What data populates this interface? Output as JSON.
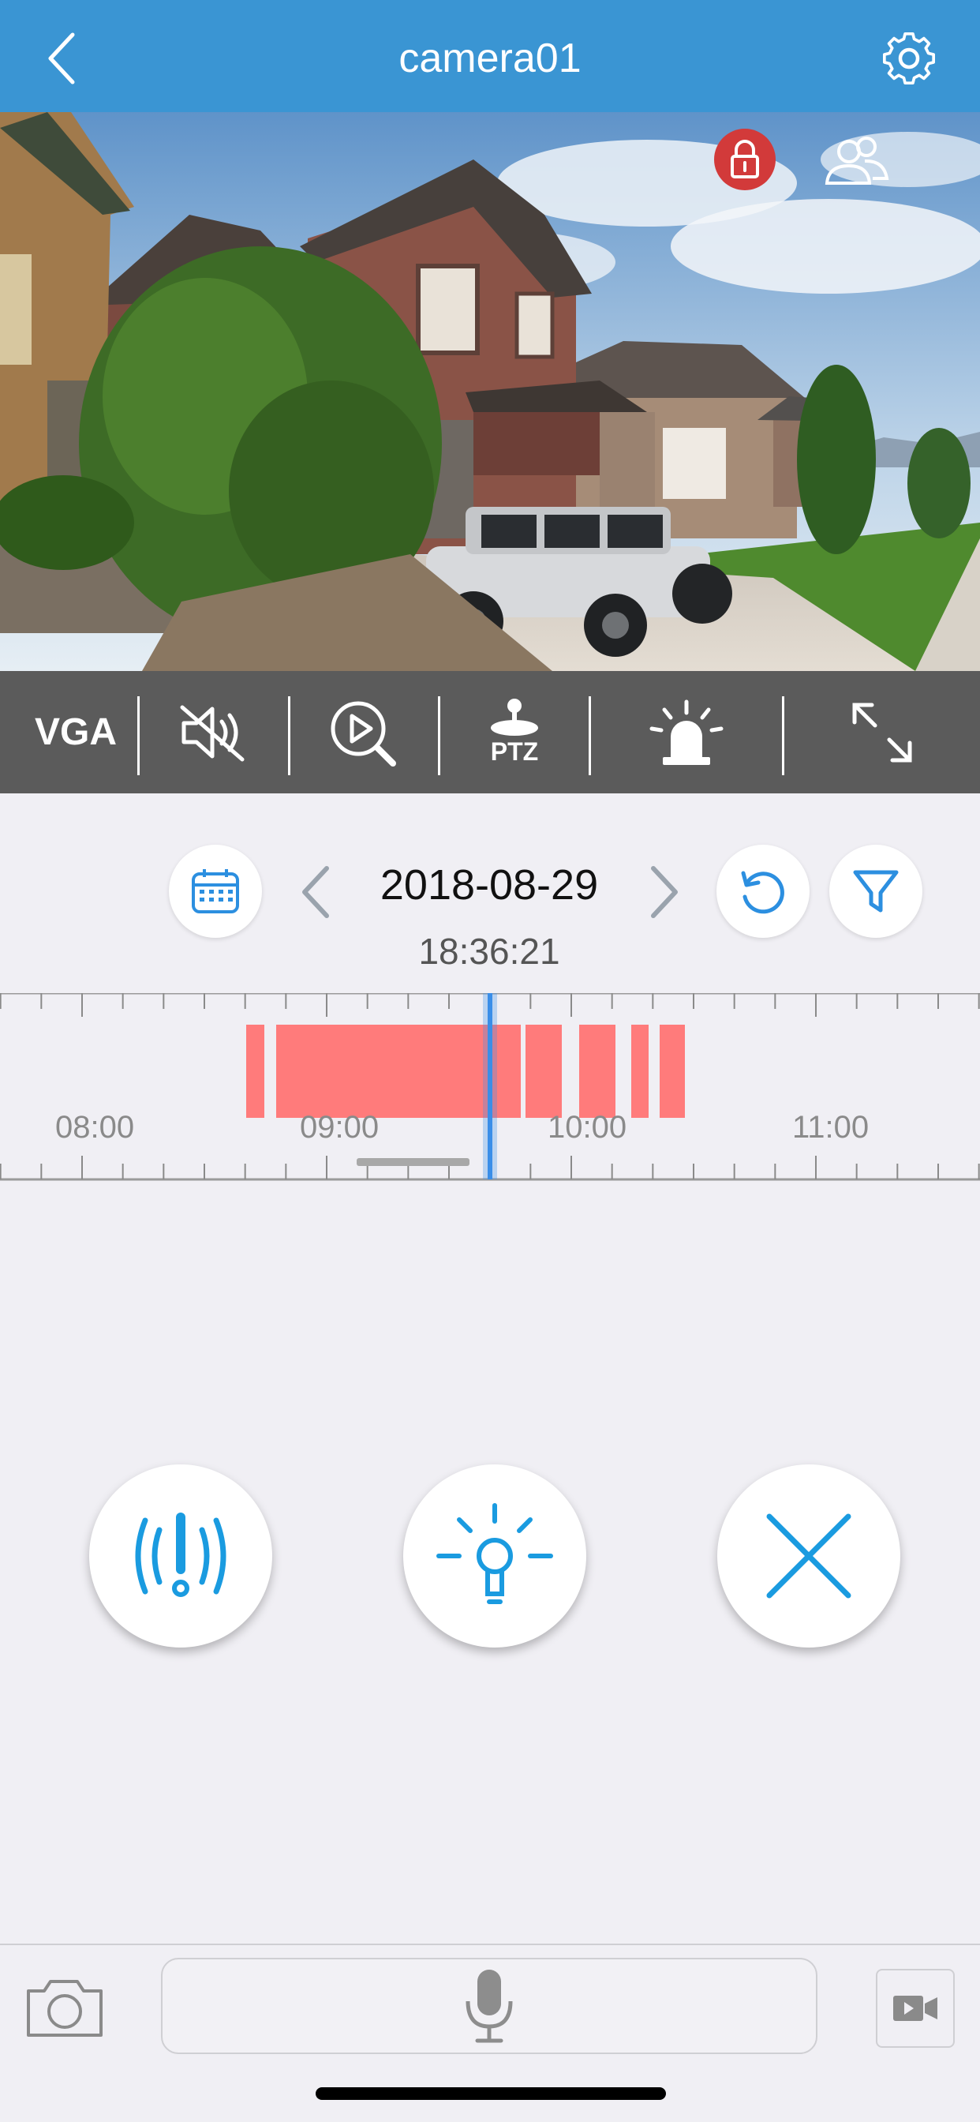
{
  "header": {
    "title": "camera01",
    "back_icon": "chevron-left-icon",
    "settings_icon": "gear-icon"
  },
  "video": {
    "lock_icon": "lock-icon",
    "users_icon": "users-icon",
    "lock_color": "#d23a3a"
  },
  "toolbar": {
    "resolution_label": "VGA",
    "mute_icon": "speaker-muted-icon",
    "playback_icon": "playback-search-icon",
    "ptz_label": "PTZ",
    "alarm_icon": "siren-icon",
    "fullscreen_icon": "expand-icon"
  },
  "date_nav": {
    "date": "2018-08-29",
    "time": "18:36:21",
    "calendar_icon": "calendar-icon",
    "refresh_icon": "refresh-icon",
    "filter_icon": "filter-icon"
  },
  "timeline": {
    "labels": [
      "08:00",
      "09:00",
      "10:00",
      "11:00"
    ],
    "recording_color": "#ff7b7b",
    "cursor_color": "#3a8ee8"
  },
  "actions": {
    "alert_icon": "alert-icon",
    "light_icon": "light-bulb-icon",
    "close_icon": "close-icon",
    "accent": "#1a9be0"
  },
  "bottom": {
    "snapshot_icon": "camera-icon",
    "mic_icon": "microphone-icon",
    "record_icon": "video-record-icon"
  }
}
